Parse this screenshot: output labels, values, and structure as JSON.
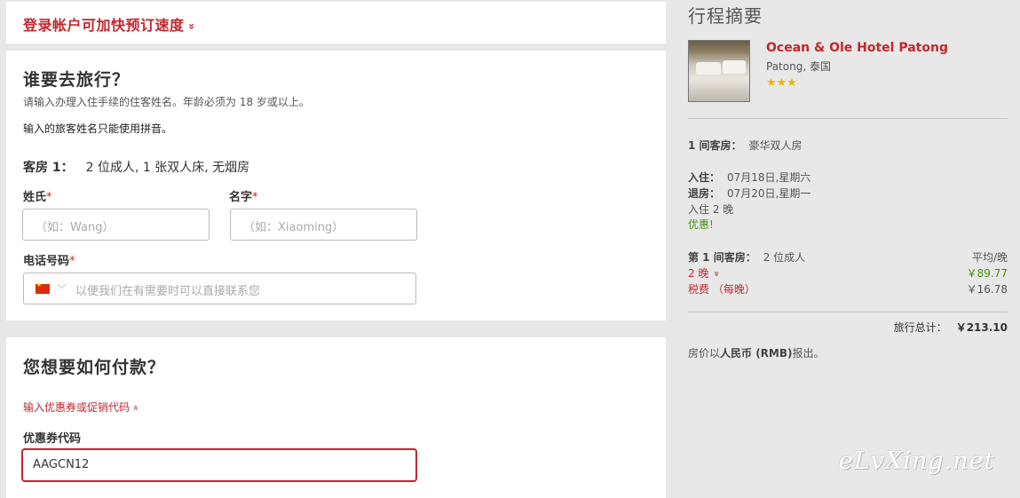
{
  "login": {
    "text": "登录帐户可加快预订速度",
    "chevron": "»"
  },
  "traveler": {
    "title": "谁要去旅行？",
    "hint_age": "请输入办理入住手续的住客姓名。年龄必须为 18 岁或以上。",
    "hint_pinyin": "输入的旅客姓名只能使用拼音。",
    "room_label": "客房 1：",
    "room_desc": "2 位成人, 1 张双人床, 无烟房",
    "surname_label": "姓氏",
    "surname_placeholder": "（如：Wang）",
    "given_label": "名字",
    "given_placeholder": "（如：Xiaoming）",
    "phone_label": "电话号码",
    "phone_placeholder": "以便我们在有需要时可以直接联系您",
    "required_mark": "*"
  },
  "payment": {
    "title": "您想要如何付款？",
    "promo_toggle": "输入优惠券或促销代码",
    "promo_chevron": "»",
    "coupon_label": "优惠券代码",
    "coupon_value": "AAGCN12"
  },
  "summary": {
    "title": "行程摘要",
    "hotel_name": "Ocean & Ole Hotel Patong",
    "hotel_location": "Patong, 泰国",
    "stars": "★★★",
    "room_count_label": "1 间客房：",
    "room_type": "豪华双人房",
    "checkin_label": "入住：",
    "checkin_date": "07月18日,星期六",
    "checkout_label": "退房：",
    "checkout_date": "07月20日,星期一",
    "nights": "入住 2 晚",
    "deal": "优惠!",
    "room1_label": "第 1 间客房：",
    "room1_guests": "2 位成人",
    "avg_label": "平均/晚",
    "nights_toggle": "2 晚",
    "nights_chevron": "»",
    "avg_price": "￥89.77",
    "tax_label": "税费 （每晚）",
    "tax_price": "￥16.78",
    "total_label": "旅行总计：",
    "total_value": "￥213.10",
    "currency_note_prefix": "房价以",
    "currency_note_bold": "人民币 (RMB)",
    "currency_note_suffix": "报出。"
  },
  "watermark": "eLvXing.net",
  "colors": {
    "accent_red": "#c1272d",
    "green": "#4a8a0e",
    "star": "#f0b400"
  }
}
